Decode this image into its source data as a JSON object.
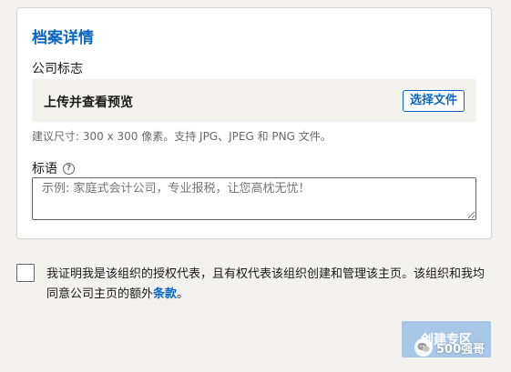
{
  "colors": {
    "accent": "#0a66c2",
    "page_background": "#f3f2ef",
    "disabled_button": "#a8c6e8"
  },
  "card": {
    "title": "档案详情",
    "logo_label": "公司标志",
    "upload_text": "上传并查看预览",
    "choose_file_label": "选择文件",
    "hint": "建议尺寸: 300 x 300 像素。支持 JPG、JPEG 和 PNG 文件。",
    "tagline_label": "标语",
    "tagline_help_icon": "question-circle-icon",
    "tagline_value": "",
    "tagline_placeholder": "示例: 家庭式会计公司，专业报税，让您高枕无忧！"
  },
  "consent": {
    "checked": false,
    "text": "我证明我是该组织的授权代表，且有权代表该组织创建和管理该主页。该组织和我均同意公司主页的额外",
    "link_text": "条款",
    "suffix": "。"
  },
  "footer": {
    "create_button_label": "创建专区",
    "create_button_disabled": true
  },
  "watermark": {
    "text": "500强哥",
    "icon": "wechat-icon"
  }
}
